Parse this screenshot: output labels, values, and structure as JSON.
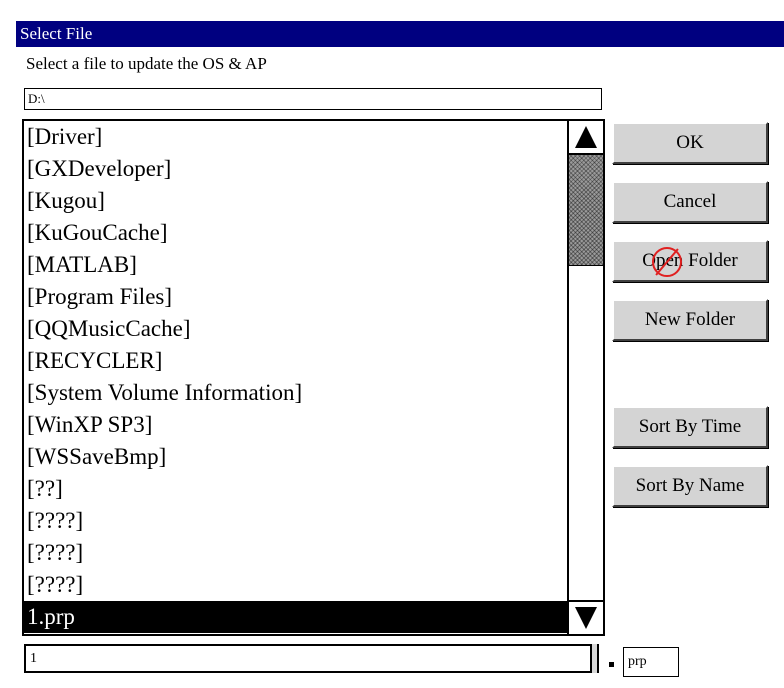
{
  "dialog": {
    "title": "Select File",
    "instruction": "Select a file to update the OS & AP",
    "path": "D:\\"
  },
  "file_list": [
    {
      "label": "[Driver]",
      "selected": false
    },
    {
      "label": "[GXDeveloper]",
      "selected": false
    },
    {
      "label": "[Kugou]",
      "selected": false
    },
    {
      "label": "[KuGouCache]",
      "selected": false
    },
    {
      "label": "[MATLAB]",
      "selected": false
    },
    {
      "label": "[Program Files]",
      "selected": false
    },
    {
      "label": "[QQMusicCache]",
      "selected": false
    },
    {
      "label": "[RECYCLER]",
      "selected": false
    },
    {
      "label": "[System Volume Information]",
      "selected": false
    },
    {
      "label": "[WinXP SP3]",
      "selected": false
    },
    {
      "label": "[WSSaveBmp]",
      "selected": false
    },
    {
      "label": "[??]",
      "selected": false
    },
    {
      "label": "[????]",
      "selected": false
    },
    {
      "label": "[????]",
      "selected": false
    },
    {
      "label": "[????]",
      "selected": false
    },
    {
      "label": "1.prp",
      "selected": true
    }
  ],
  "buttons": {
    "ok": "OK",
    "cancel": "Cancel",
    "open_folder": "Open Folder",
    "new_folder": "New Folder",
    "sort_by_time": "Sort By Time",
    "sort_by_name": "Sort By Name"
  },
  "filename": {
    "name": "1",
    "separator": ".",
    "extension": "prp"
  },
  "icons": {
    "scroll_up": "scroll-up-arrow-icon",
    "scroll_down": "scroll-down-arrow-icon",
    "cursor": "touch-cursor-icon"
  },
  "colors": {
    "title_bar": "#000080",
    "selection": "#000000",
    "button_face": "#d4d4d4",
    "cursor": "#e02020"
  }
}
